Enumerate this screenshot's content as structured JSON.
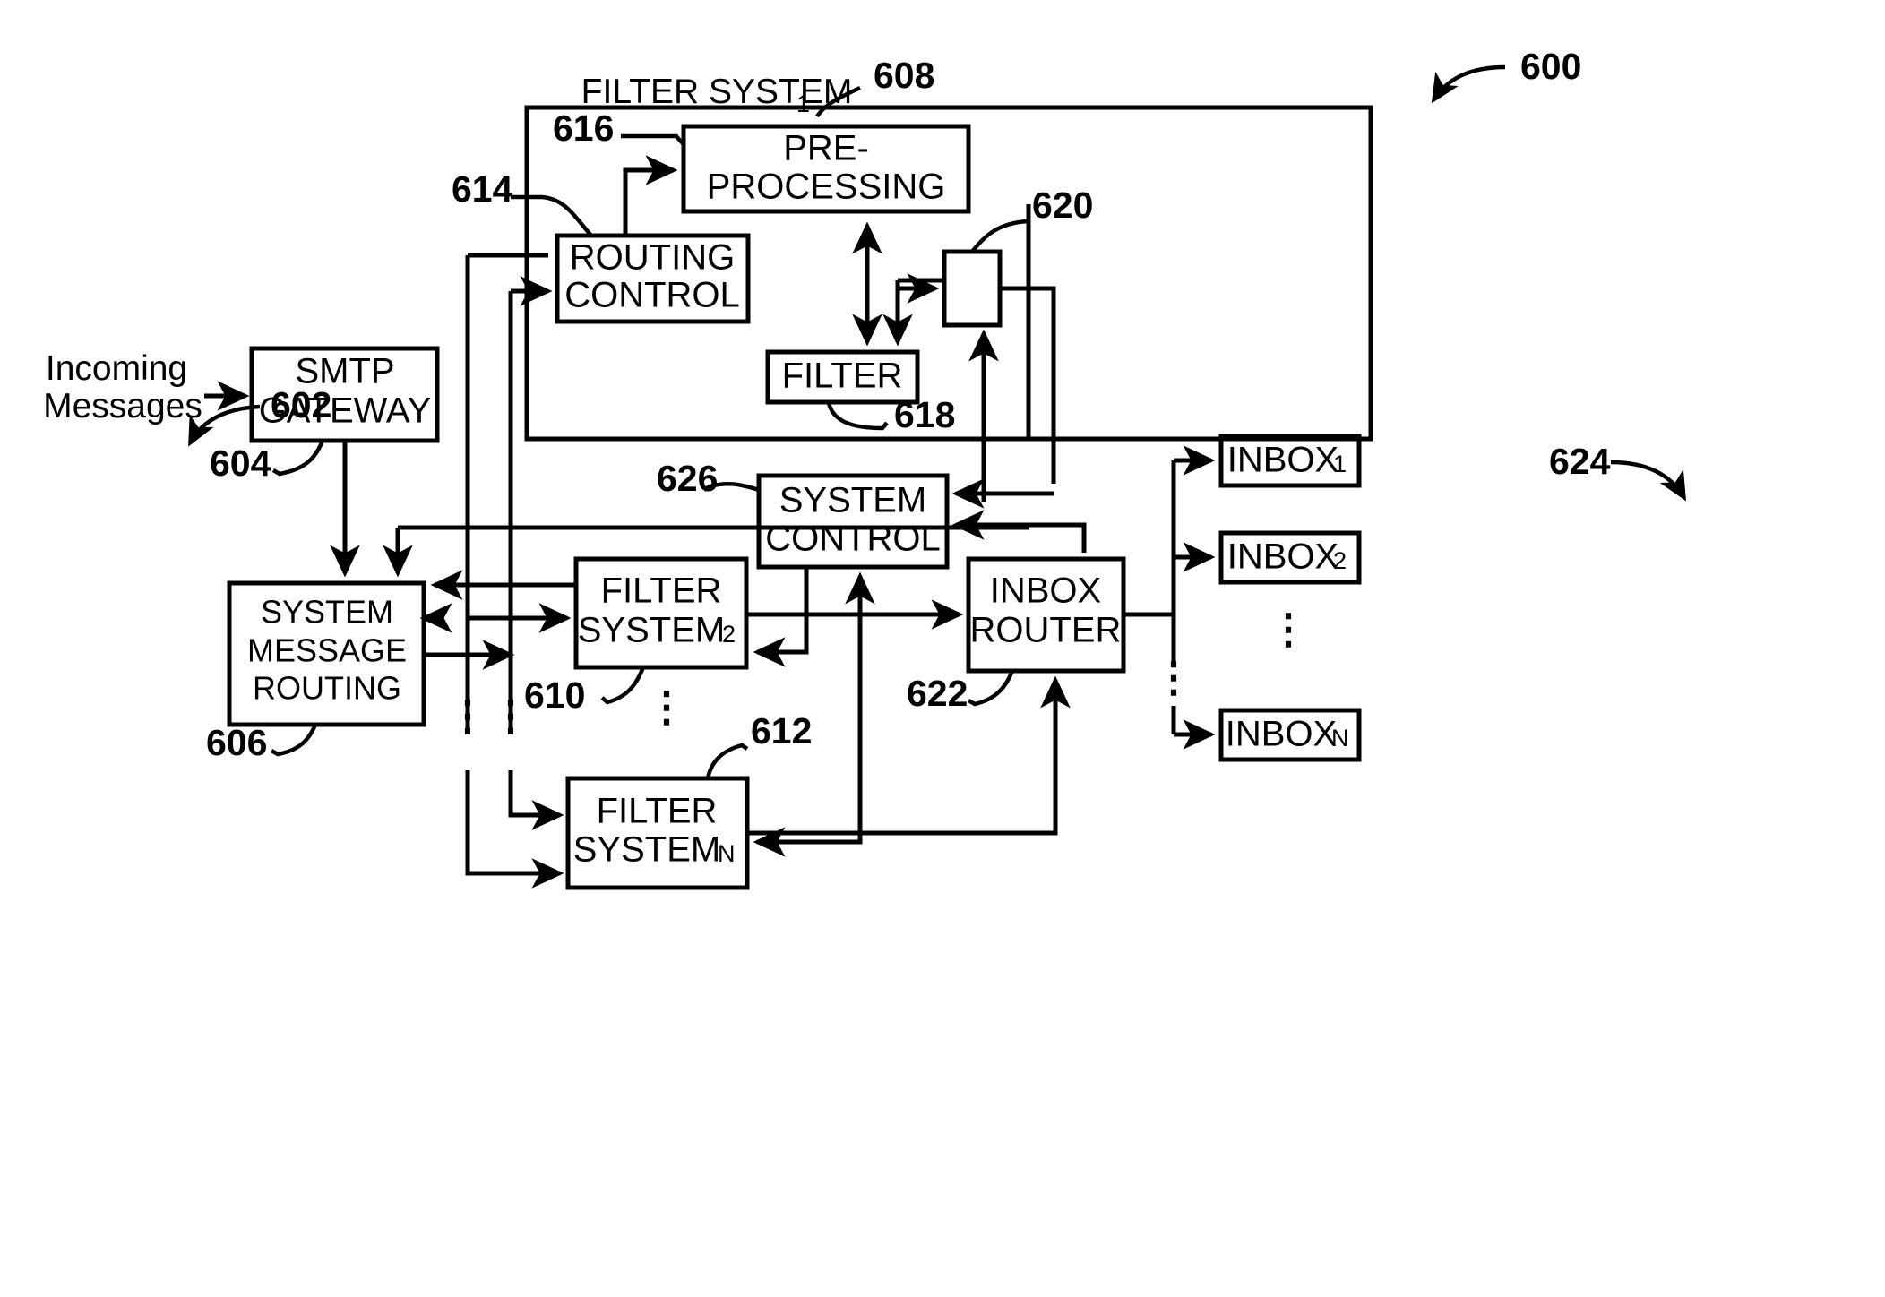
{
  "figure": {
    "figure_number": "600",
    "title_label": "FILTER SYSTEM",
    "title_label_sub": "1"
  },
  "reference_numerals": {
    "n600": "600",
    "n602": "602",
    "n604": "604",
    "n606": "606",
    "n608": "608",
    "n610": "610",
    "n612": "612",
    "n614": "614",
    "n616": "616",
    "n618": "618",
    "n620": "620",
    "n622": "622",
    "n624": "624",
    "n626": "626"
  },
  "blocks": {
    "incoming_messages": {
      "line1": "Incoming",
      "line2": "Messages"
    },
    "smtp_gateway": {
      "line1": "SMTP",
      "line2": "GATEWAY"
    },
    "system_message_routing": {
      "line1": "SYSTEM",
      "line2": "MESSAGE",
      "line3": "ROUTING"
    },
    "pre_processing": {
      "line1": "PRE-",
      "line2": "PROCESSING"
    },
    "routing_control": {
      "line1": "ROUTING",
      "line2": "CONTROL"
    },
    "filter": {
      "line1": "FILTER"
    },
    "switch_620": {
      "line1": ""
    },
    "filter_system_2": {
      "line1": "FILTER",
      "line2": "SYSTEM",
      "sub": "2"
    },
    "filter_system_n": {
      "line1": "FILTER",
      "line2": "SYSTEM",
      "sub": "N"
    },
    "system_control": {
      "line1": "SYSTEM",
      "line2": "CONTROL"
    },
    "inbox_router": {
      "line1": "INBOX",
      "line2": "ROUTER"
    },
    "inbox_1": {
      "line1": "INBOX",
      "sub": "1"
    },
    "inbox_2": {
      "line1": "INBOX",
      "sub": "2"
    },
    "inbox_n": {
      "line1": "INBOX",
      "sub": "N"
    }
  },
  "ellipsis": {
    "vertical_dots": "⋮",
    "inbox_dots": "⋮"
  },
  "colors": {
    "stroke": "#000000",
    "background": "#ffffff"
  }
}
